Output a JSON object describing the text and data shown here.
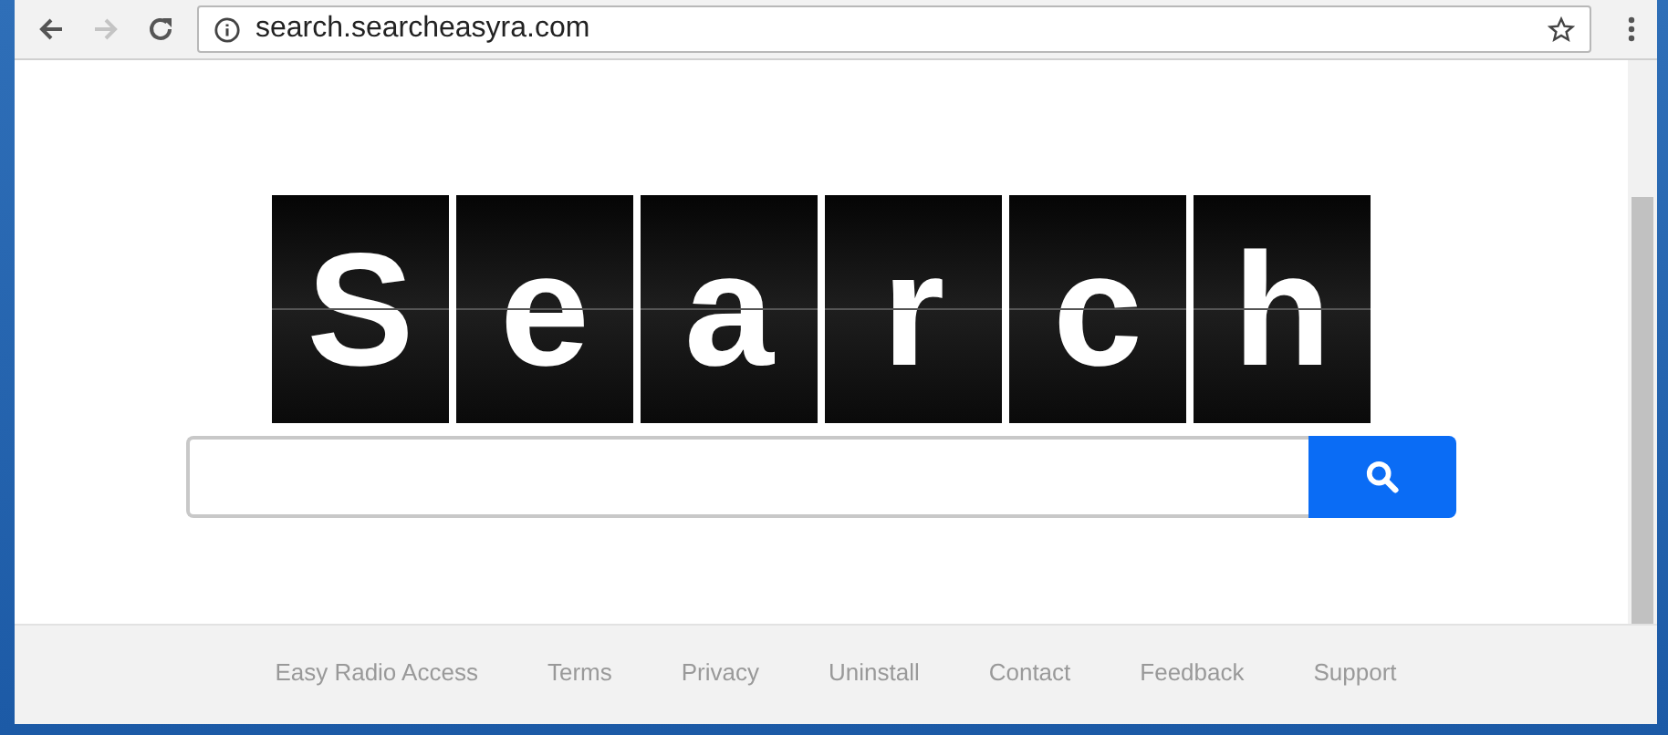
{
  "browser": {
    "url": "search.searcheasyra.com"
  },
  "logo": {
    "letters": [
      "S",
      "e",
      "a",
      "r",
      "c",
      "h"
    ]
  },
  "footer": {
    "links": [
      "Easy Radio Access",
      "Terms",
      "Privacy",
      "Uninstall",
      "Contact",
      "Feedback",
      "Support"
    ]
  }
}
